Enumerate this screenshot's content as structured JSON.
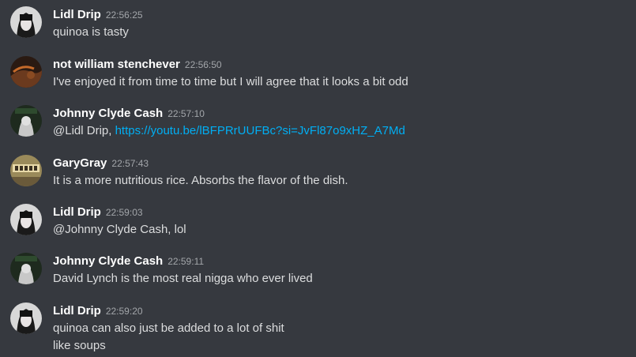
{
  "colors": {
    "background": "#36393f",
    "username": "#ffffff",
    "timestamp": "#a3a6aa",
    "text": "#dcddde",
    "link": "#00aff4"
  },
  "messages": [
    {
      "username": "Lidl Drip",
      "timestamp": "22:56:25",
      "avatar": "lidl-drip-avatar",
      "lines": [
        "quinoa is tasty"
      ]
    },
    {
      "username": "not william stenchever",
      "timestamp": "22:56:50",
      "avatar": "stenchever-avatar",
      "lines": [
        "I've enjoyed it from time to time but I will agree that it looks a bit odd"
      ]
    },
    {
      "username": "Johnny Clyde Cash",
      "timestamp": "22:57:10",
      "avatar": "johnny-clyde-cash-avatar",
      "mention": "@Lidl Drip,",
      "link": "https://youtu.be/lBFPRrUUFBc?si=JvFl87o9xHZ_A7Md"
    },
    {
      "username": "GaryGray",
      "timestamp": "22:57:43",
      "avatar": "garygray-avatar",
      "lines": [
        "It is a more nutritious rice. Absorbs the flavor of the dish."
      ]
    },
    {
      "username": "Lidl Drip",
      "timestamp": "22:59:03",
      "avatar": "lidl-drip-avatar",
      "lines": [
        "@Johnny Clyde Cash, lol"
      ]
    },
    {
      "username": "Johnny Clyde Cash",
      "timestamp": "22:59:11",
      "avatar": "johnny-clyde-cash-avatar",
      "lines": [
        "David Lynch is the most real nigga who ever lived"
      ]
    },
    {
      "username": "Lidl Drip",
      "timestamp": "22:59:20",
      "avatar": "lidl-drip-avatar",
      "lines": [
        "quinoa can also just be added to a lot of shit",
        "like soups"
      ]
    }
  ]
}
